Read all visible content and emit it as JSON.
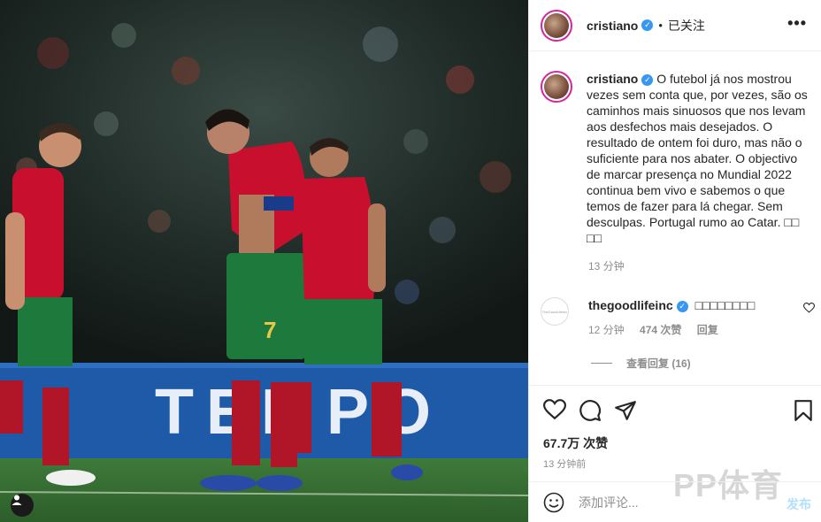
{
  "photo": {
    "ad_board_text": "TEMPO",
    "player_number": "7"
  },
  "header": {
    "username": "cristiano",
    "separator": "•",
    "follow_state": "已关注",
    "more_label": "•••"
  },
  "caption": {
    "username": "cristiano",
    "text": "O futebol já nos mostrou vezes sem conta que, por vezes, são os caminhos mais sinuosos que nos levam aos desfechos mais desejados. O resultado de ontem foi duro, mas não o suficiente para nos abater. O objectivo de marcar presença no Mundial 2022 continua bem vivo e sabemos o que temos de fazer para lá chegar. Sem desculpas. Portugal rumo ao Catar. □□ □□",
    "time": "13 分钟"
  },
  "comment": {
    "username": "thegoodlifeinc",
    "text": "□□□□□□□□",
    "avatar_text": "TheGoodLifeInc",
    "time": "12 分钟",
    "likes": "474 次赞",
    "reply_label": "回复",
    "view_replies": "查看回复 (16)"
  },
  "post": {
    "likes": "67.7万 次赞",
    "time": "13 分钟前",
    "watermark": "PP体育"
  },
  "add_comment": {
    "placeholder": "添加评论...",
    "post_label": "发布"
  },
  "colors": {
    "accent_blue": "#3897f0",
    "post_button_disabled": "#b2dffc",
    "muted": "#8e8e8e",
    "jersey_red": "#c8102e",
    "shorts_green": "#1e7a3c"
  }
}
